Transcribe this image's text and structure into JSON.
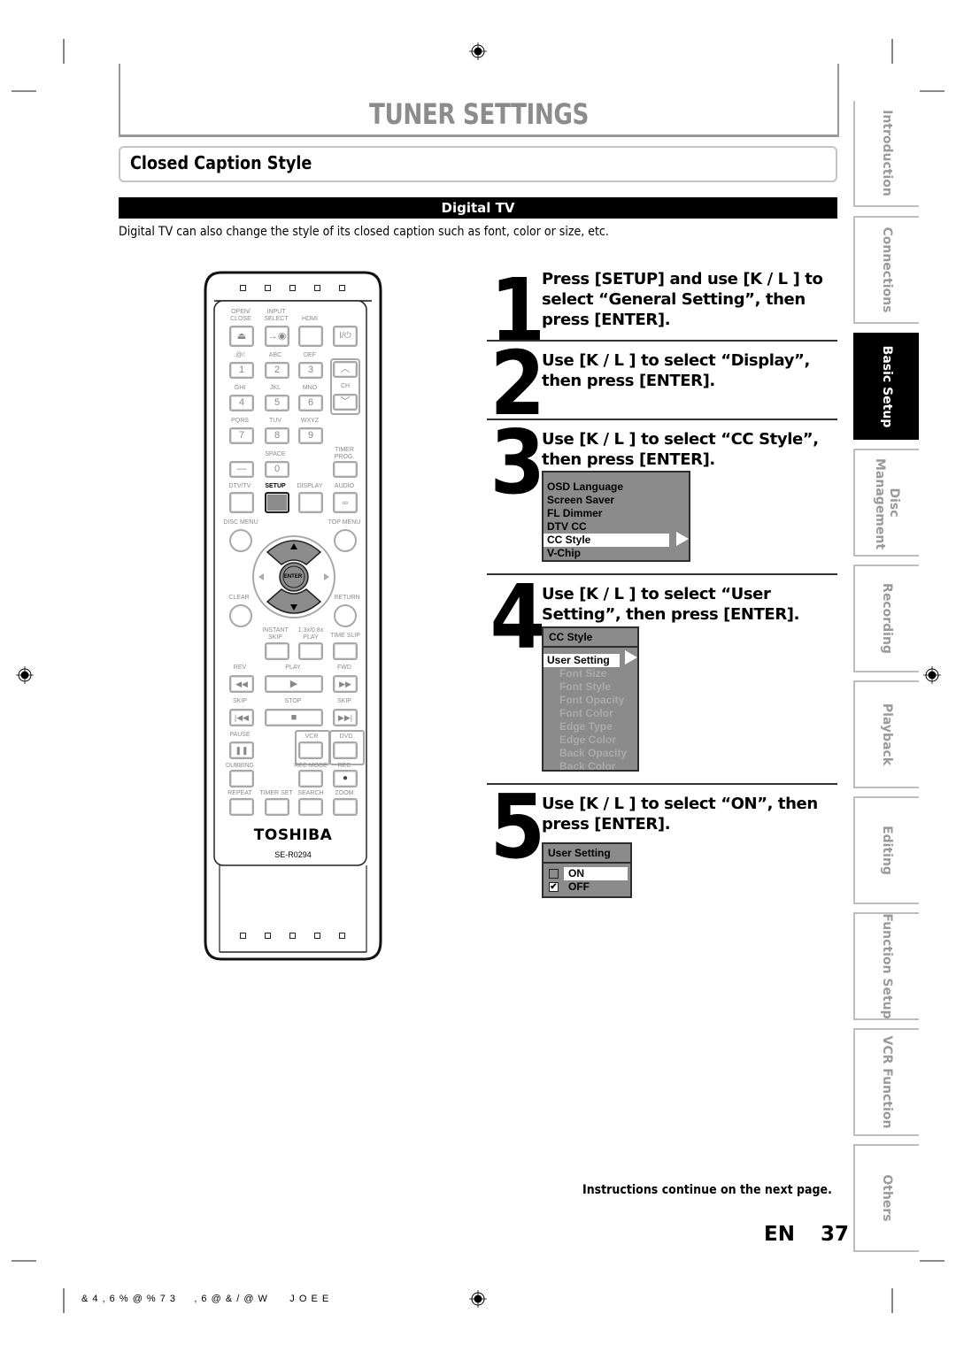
{
  "page": {
    "title": "TUNER SETTINGS",
    "section_title": "Closed Caption Style",
    "subsection_bar": "Digital TV",
    "intro_text": "Digital TV can also change the style of its closed caption such as font, color or size, etc.",
    "continue_note": "Instructions continue on the next page.",
    "lang_label": "EN",
    "page_number": "37",
    "footer_code": "& 4 , 6 % @ % 7 3     , 6 @ & / @ W      J O E E"
  },
  "steps": [
    {
      "num": "1",
      "text": "Press [SETUP] and use [K / L ] to select “General Setting”, then press [ENTER]."
    },
    {
      "num": "2",
      "text": "Use [K / L ] to select “Display”, then press [ENTER]."
    },
    {
      "num": "3",
      "text": "Use [K / L ] to select “CC Style”, then press [ENTER]."
    },
    {
      "num": "4",
      "text": "Use [K / L ] to select “User Setting”, then press [ENTER]."
    },
    {
      "num": "5",
      "text": "Use [K / L ] to select “ON”, then press [ENTER]."
    }
  ],
  "menus": {
    "display_menu": {
      "items": [
        "OSD Language",
        "Screen Saver",
        "FL Dimmer",
        "DTV CC",
        "CC Style",
        "V-Chip"
      ],
      "selected": "CC Style"
    },
    "cc_style_menu": {
      "header": "CC Style",
      "selected": "User Setting",
      "items": [
        "Font Size",
        "Font Style",
        "Font Opacity",
        "Font Color",
        "Edge Type",
        "Edge Color",
        "Back Opacity",
        "Back Color"
      ]
    },
    "user_setting_menu": {
      "header": "User Setting",
      "options": [
        {
          "label": "ON",
          "checked": false,
          "highlighted": true
        },
        {
          "label": "OFF",
          "checked": true,
          "highlighted": false
        }
      ]
    }
  },
  "side_tabs": [
    {
      "label": "Introduction",
      "active": false
    },
    {
      "label": "Connections",
      "active": false
    },
    {
      "label": "Basic Setup",
      "active": true
    },
    {
      "label": "Disc Management",
      "active": false
    },
    {
      "label": "Recording",
      "active": false
    },
    {
      "label": "Playback",
      "active": false
    },
    {
      "label": "Editing",
      "active": false
    },
    {
      "label": "Function Setup",
      "active": false
    },
    {
      "label": "VCR Function",
      "active": false
    },
    {
      "label": "Others",
      "active": false
    }
  ],
  "remote": {
    "brand": "TOSHIBA",
    "model": "SE-R0294",
    "labels": {
      "open_close": "OPEN/\nCLOSE",
      "input_select": "INPUT\nSELECT",
      "hdmi": "HDMI",
      "k1": ".@/:",
      "k2": "ABC",
      "k3": "DEF",
      "k4": "GHI",
      "k5": "JKL",
      "k6": "MNO",
      "k7": "PQRS",
      "k8": "TUV",
      "k9": "WXYZ",
      "ch": "CH",
      "space": "SPACE",
      "timer_prog": "TIMER\nPROG.",
      "dtv_tv": "DTV/TV",
      "setup": "SETUP",
      "display": "DISPLAY",
      "audio": "AUDIO",
      "disc_menu": "DISC MENU",
      "top_menu": "TOP MENU",
      "enter": "ENTER",
      "clear": "CLEAR",
      "return": "RETURN",
      "instant_skip": "INSTANT\nSKIP",
      "play_speed": "1.3x/0.8x\nPLAY",
      "time_slip": "TIME SLIP",
      "rev": "REV",
      "play": "PLAY",
      "fwd": "FWD",
      "skip_back": "SKIP",
      "stop": "STOP",
      "skip_fwd": "SKIP",
      "pause": "PAUSE",
      "vcr": "VCR",
      "dvd": "DVD",
      "dubbing": "DUBBING",
      "rec_mode": "REC MODE",
      "rec": "REC",
      "repeat": "REPEAT",
      "timer_set": "TIMER SET",
      "search": "SEARCH",
      "zoom": "ZOOM"
    },
    "keys": {
      "k1": "1",
      "k2": "2",
      "k3": "3",
      "k4": "4",
      "k5": "5",
      "k6": "6",
      "k7": "7",
      "k8": "8",
      "k9": "9",
      "k0": "0",
      "dash": "—",
      "power": "I/⏻"
    }
  }
}
